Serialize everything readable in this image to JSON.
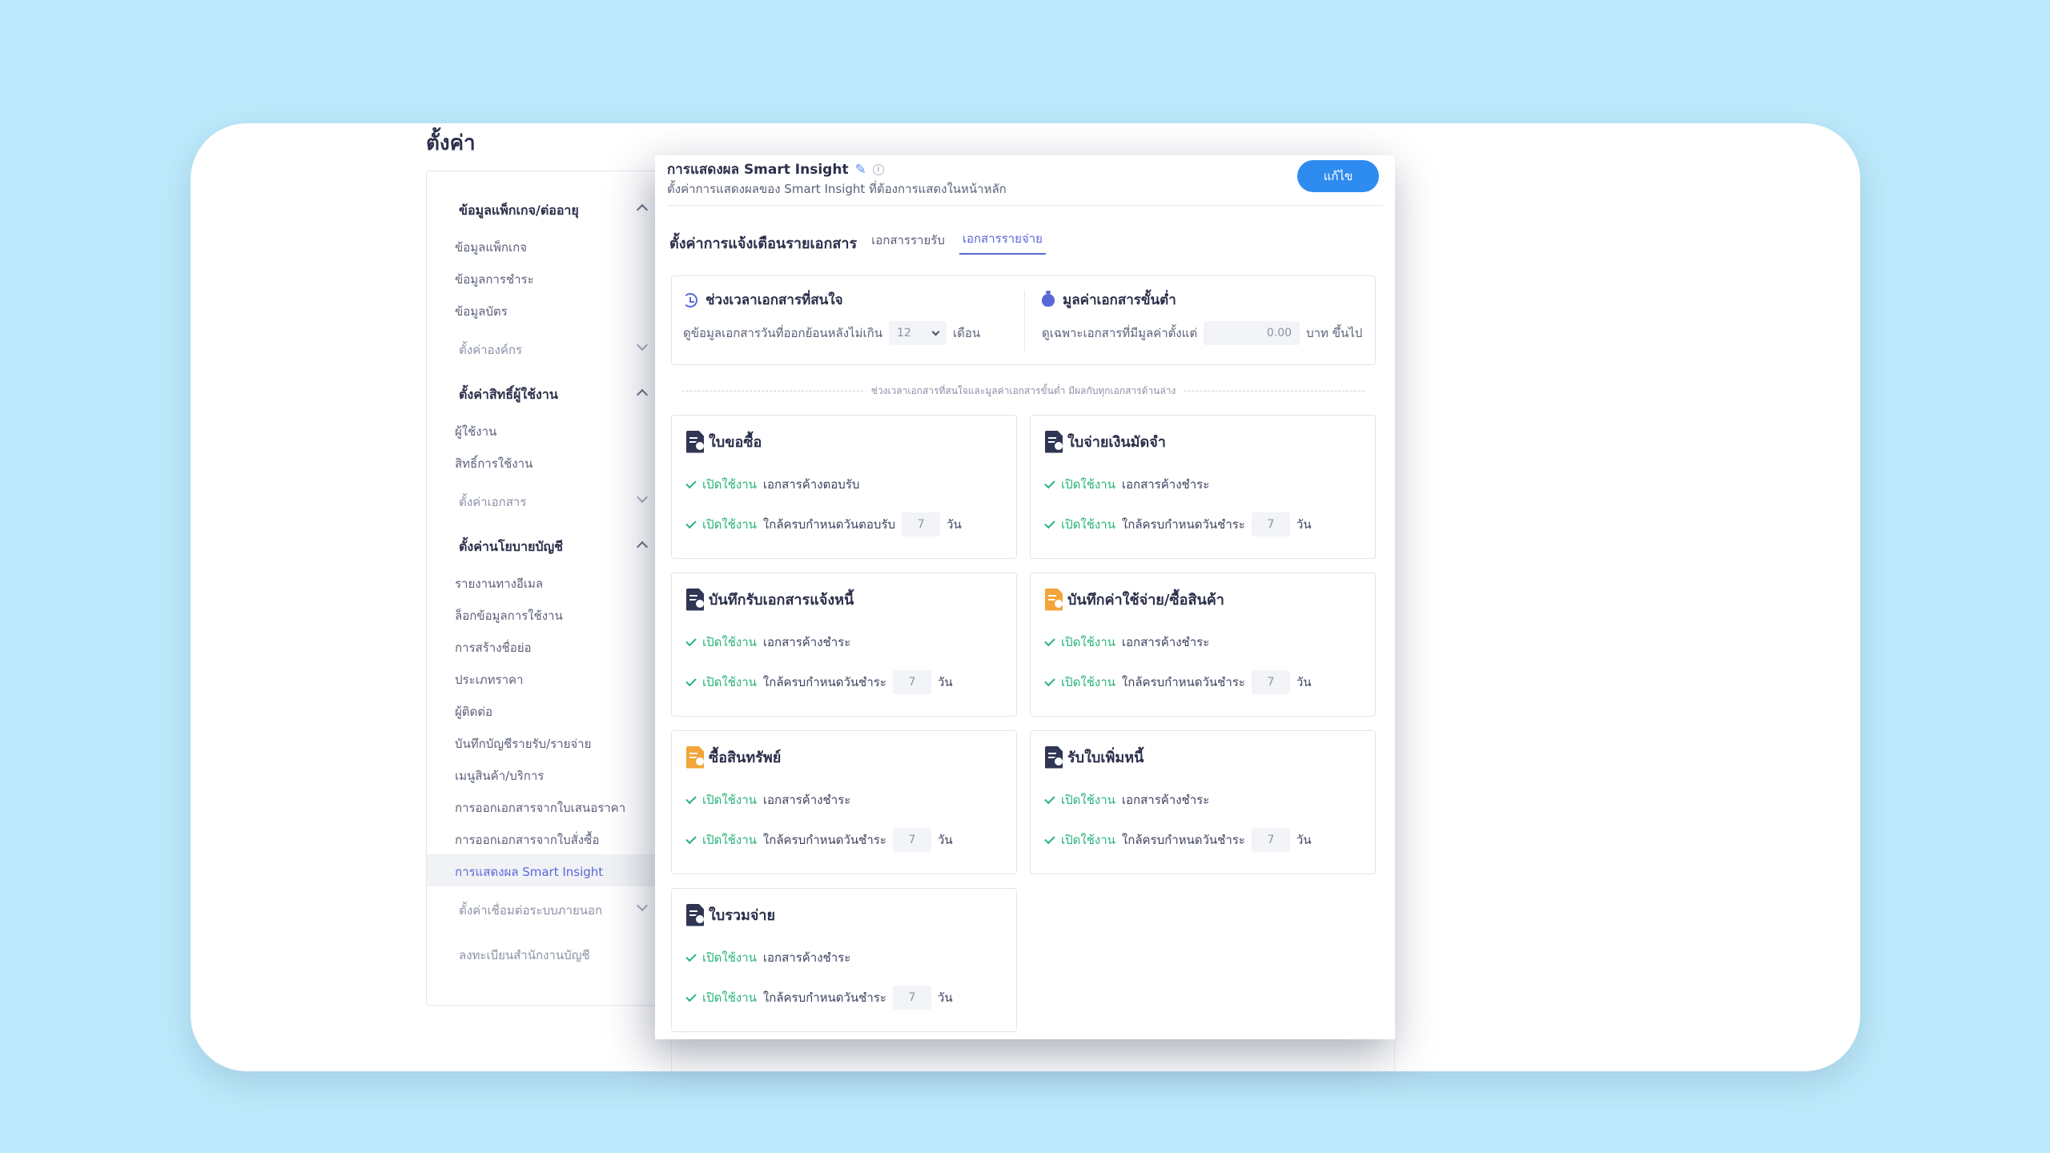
{
  "page_title": "ตั้งค่า",
  "sidebar": {
    "sections": [
      {
        "label": "ข้อมูลแพ็กเกจ/ต่ออายุ",
        "items": [
          "ข้อมูลแพ็กเกจ",
          "ข้อมูลการชำระ",
          "ข้อมูลบัตร"
        ]
      },
      {
        "label": "ตั้งค่าองค์กร"
      },
      {
        "label": "ตั้งค่าสิทธิ์ผู้ใช้งาน",
        "items": [
          "ผู้ใช้งาน",
          "สิทธิ์การใช้งาน"
        ]
      },
      {
        "label": "ตั้งค่าเอกสาร"
      },
      {
        "label": "ตั้งค่านโยบายบัญชี",
        "items": [
          "รายงานทางอีเมล",
          "ล็อกข้อมูลการใช้งาน",
          "การสร้างชื่อย่อ",
          "ประเภทราคา",
          "ผู้ติดต่อ",
          "บันทึกบัญชีรายรับ/รายจ่าย",
          "เมนูสินค้า/บริการ",
          "การออกเอกสารจากใบเสนอราคา",
          "การออกเอกสารจากใบสั่งซื้อ",
          "การแสดงผล Smart Insight"
        ]
      },
      {
        "label": "ตั้งค่าเชื่อมต่อระบบภายนอก"
      },
      {
        "label": "ลงทะเบียนสำนักงานบัญชี"
      }
    ]
  },
  "panel": {
    "title": "การแสดงผล Smart Insight",
    "subtitle": "ตั้งค่าการแสดงผลของ Smart Insight ที่ต้องการแสดงในหน้าหลัก",
    "edit_label": "แก้ไข",
    "tabs_title": "ตั้งค่าการแจ้งเตือนรายเอกสาร",
    "tabs": [
      "เอกสารรายรับ",
      "เอกสารรายจ่าย"
    ],
    "active_tab": "เอกสารรายจ่าย"
  },
  "settings": {
    "period": {
      "title": "ช่วงเวลาเอกสารที่สนใจ",
      "prefix": "ดูข้อมูลเอกสารวันที่ออกย้อนหลังไม่เกิน",
      "value": "12",
      "suffix": "เดือน"
    },
    "minimum": {
      "title": "มูลค่าเอกสารขั้นต่ำ",
      "prefix": "ดูเฉพาะเอกสารที่มีมูลค่าตั้งแต่",
      "value": "0.00",
      "suffix": "บาท ขึ้นไป"
    },
    "note": "ช่วงเวลาเอกสารที่สนใจและมูลค่าเอกสารขั้นต่ำ มีผลกับทุกเอกสารด้านล่าง"
  },
  "status_on": "เปิดใช้งาน",
  "day_unit": "วัน",
  "cards": [
    {
      "title": "ใบขอซื้อ",
      "icon": "dark",
      "row1": "เอกสารค้างตอบรับ",
      "row2": "ใกล้ครบกำหนดวันตอบรับ",
      "days": "7"
    },
    {
      "title": "ใบจ่ายเงินมัดจำ",
      "icon": "dark",
      "row1": "เอกสารค้างชำระ",
      "row2": "ใกล้ครบกำหนดวันชำระ",
      "days": "7"
    },
    {
      "title": "บันทึกรับเอกสารแจ้งหนี้",
      "icon": "dark",
      "row1": "เอกสารค้างชำระ",
      "row2": "ใกล้ครบกำหนดวันชำระ",
      "days": "7"
    },
    {
      "title": "บันทึกค่าใช้จ่าย/ซื้อสินค้า",
      "icon": "orange",
      "row1": "เอกสารค้างชำระ",
      "row2": "ใกล้ครบกำหนดวันชำระ",
      "days": "7"
    },
    {
      "title": "ซื้อสินทรัพย์",
      "icon": "orange",
      "row1": "เอกสารค้างชำระ",
      "row2": "ใกล้ครบกำหนดวันชำระ",
      "days": "7"
    },
    {
      "title": "รับใบเพิ่มหนี้",
      "icon": "dark",
      "row1": "เอกสารค้างชำระ",
      "row2": "ใกล้ครบกำหนดวันชำระ",
      "days": "7"
    },
    {
      "title": "ใบรวมจ่าย",
      "icon": "dark",
      "row1": "เอกสารค้างชำระ",
      "row2": "ใกล้ครบกำหนดวันชำระ",
      "days": "7"
    }
  ],
  "colors": {
    "accent": "#5a67d8",
    "button": "#2e8cf0",
    "success": "#29b37a",
    "background": "#bde9fc"
  }
}
